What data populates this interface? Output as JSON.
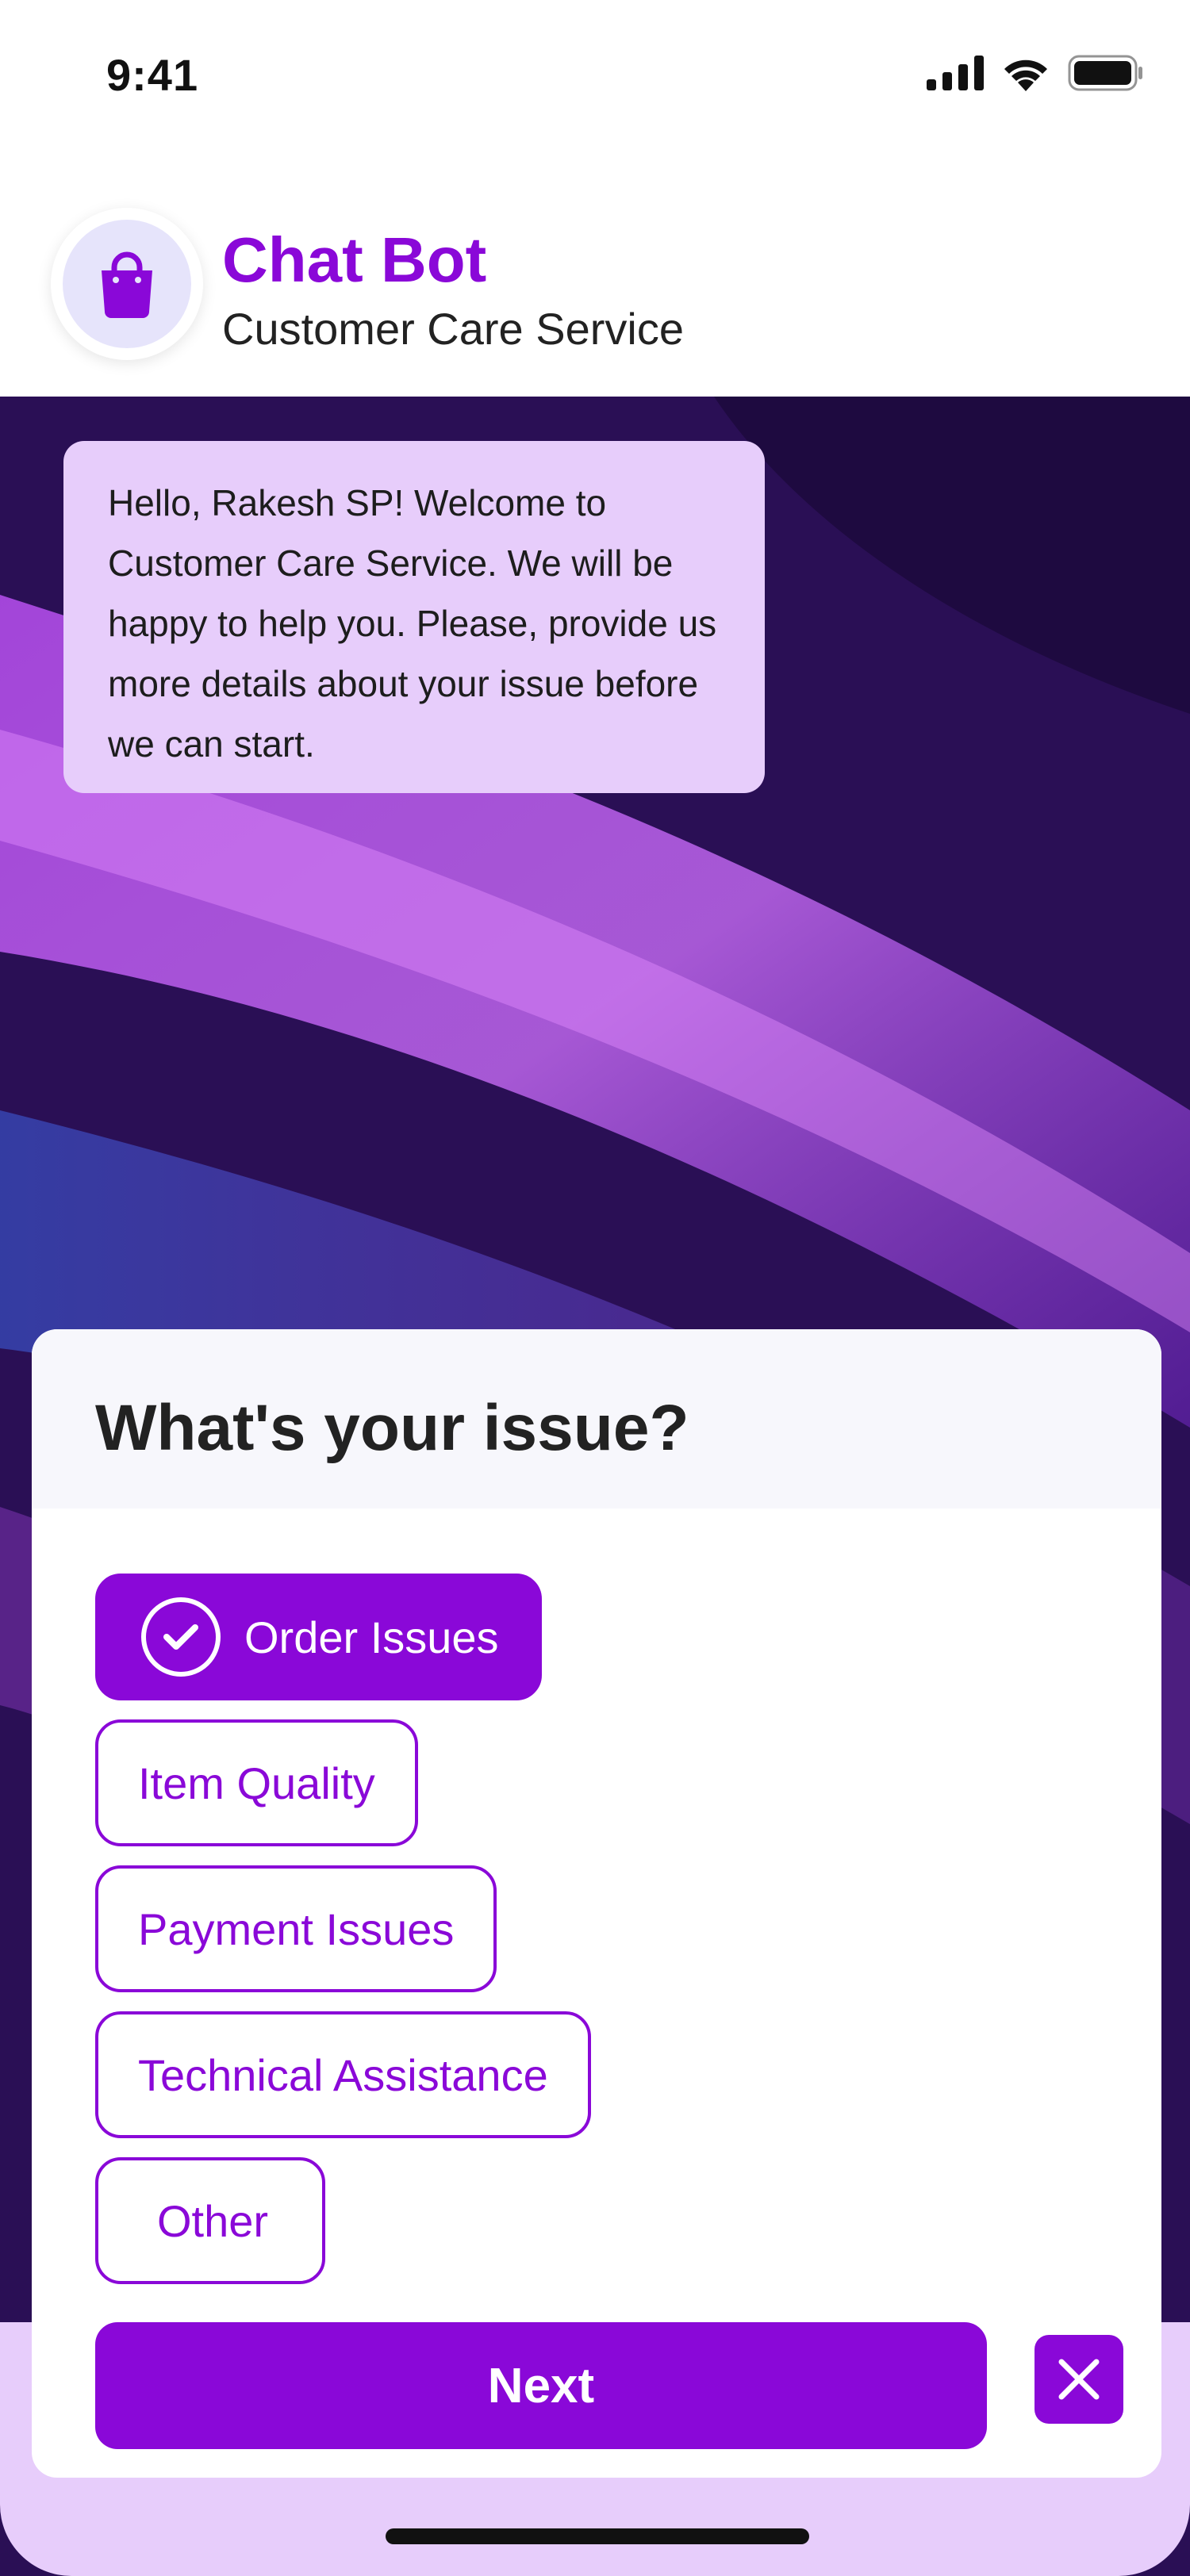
{
  "status_bar": {
    "time": "9:41"
  },
  "header": {
    "title": "Chat Bot",
    "subtitle": "Customer Care Service",
    "avatar_icon": "shopping-bag-icon"
  },
  "message": {
    "text": "Hello, Rakesh SP! Welcome to Customer Care Service. We will be happy to help you. Please, provide us more details about your issue before we can start."
  },
  "issue_sheet": {
    "title": "What's your issue?",
    "options": [
      {
        "label": "Order Issues",
        "selected": true
      },
      {
        "label": "Item Quality",
        "selected": false
      },
      {
        "label": "Payment Issues",
        "selected": false
      },
      {
        "label": "Technical Assistance",
        "selected": false
      },
      {
        "label": "Other",
        "selected": false
      }
    ],
    "next_label": "Next",
    "close_icon": "close-icon"
  },
  "colors": {
    "accent": "#8a08d8",
    "bubble": "#e7cdfb",
    "avatar_bg": "#e6e4fb"
  }
}
